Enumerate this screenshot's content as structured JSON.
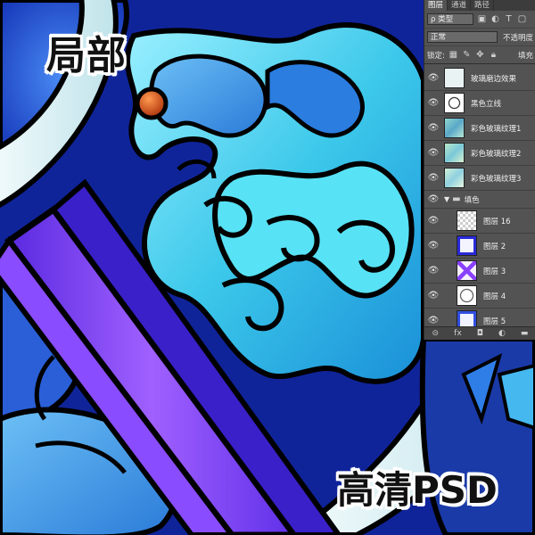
{
  "overlay": {
    "local_label": "局部",
    "hd_label": "高清PSD"
  },
  "panel": {
    "tabs": [
      "图层",
      "通道",
      "路径"
    ],
    "kind_filter": "ρ 类型",
    "blend_mode": "正常",
    "opacity_label": "不透明度",
    "lock_label": "锁定:",
    "fill_label": "填充",
    "layers": [
      {
        "name": "玻璃磨边效果",
        "thumb": "glass-edge"
      },
      {
        "name": "黑色立线",
        "thumb": "black-line"
      },
      {
        "name": "彩色玻璃纹理1",
        "thumb": "texture"
      },
      {
        "name": "彩色玻璃纹理2",
        "thumb": "texture"
      },
      {
        "name": "彩色玻璃纹理3",
        "thumb": "texture"
      }
    ],
    "group": {
      "name": "填色"
    },
    "group_layers": [
      {
        "name": "图层 16",
        "thumb": "transparent"
      },
      {
        "name": "图层 2",
        "thumb": "blue-shape"
      },
      {
        "name": "图层 3",
        "thumb": "purple-shape"
      },
      {
        "name": "图层 4",
        "thumb": "white-ring"
      },
      {
        "name": "图层 5",
        "thumb": "blue-shape"
      }
    ],
    "footer_icons": [
      "link-icon",
      "fx-icon",
      "mask-icon",
      "adjustment-icon",
      "folder-icon"
    ],
    "footer_text": [
      "⊝",
      "fx",
      "◘",
      "◐",
      "▬"
    ]
  },
  "colors": {
    "panel_bg": "#535353",
    "deep_blue": "#0a1a6e",
    "cyan": "#38d4f0",
    "purple": "#7a3cf0",
    "pale_glass": "#d8eef2",
    "orange_bead": "#d9541a"
  }
}
